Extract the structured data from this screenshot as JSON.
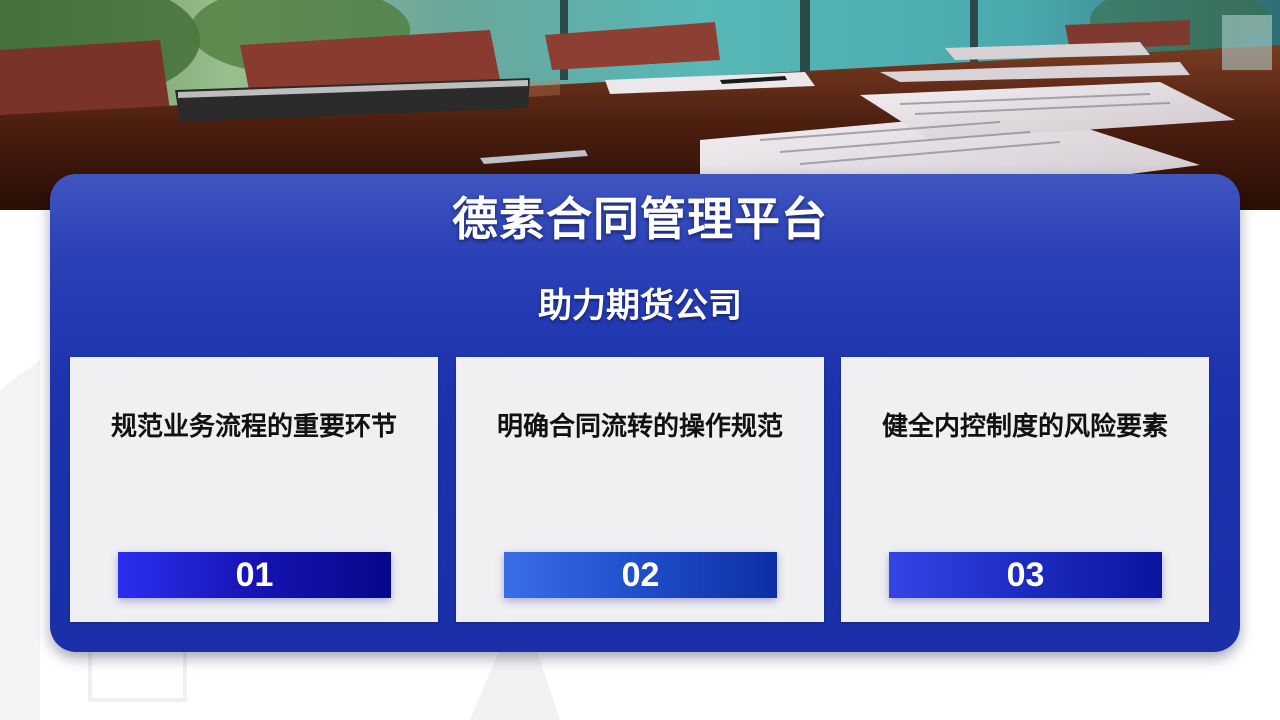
{
  "slide": {
    "title": "德素合同管理平台",
    "subtitle": "助力期货公司",
    "cards": [
      {
        "text": "规范业务流程的重要环节",
        "number": "01"
      },
      {
        "text": "明确合同流转的操作规范",
        "number": "02"
      },
      {
        "text": "健全内控制度的风险要素",
        "number": "03"
      }
    ]
  },
  "colors": {
    "panel_blue": "#1c33ad",
    "card_bg": "#f0f0f2",
    "number_bar_dark": "#07078a"
  },
  "photo": {
    "subject": "meeting-room-table-with-documents"
  }
}
